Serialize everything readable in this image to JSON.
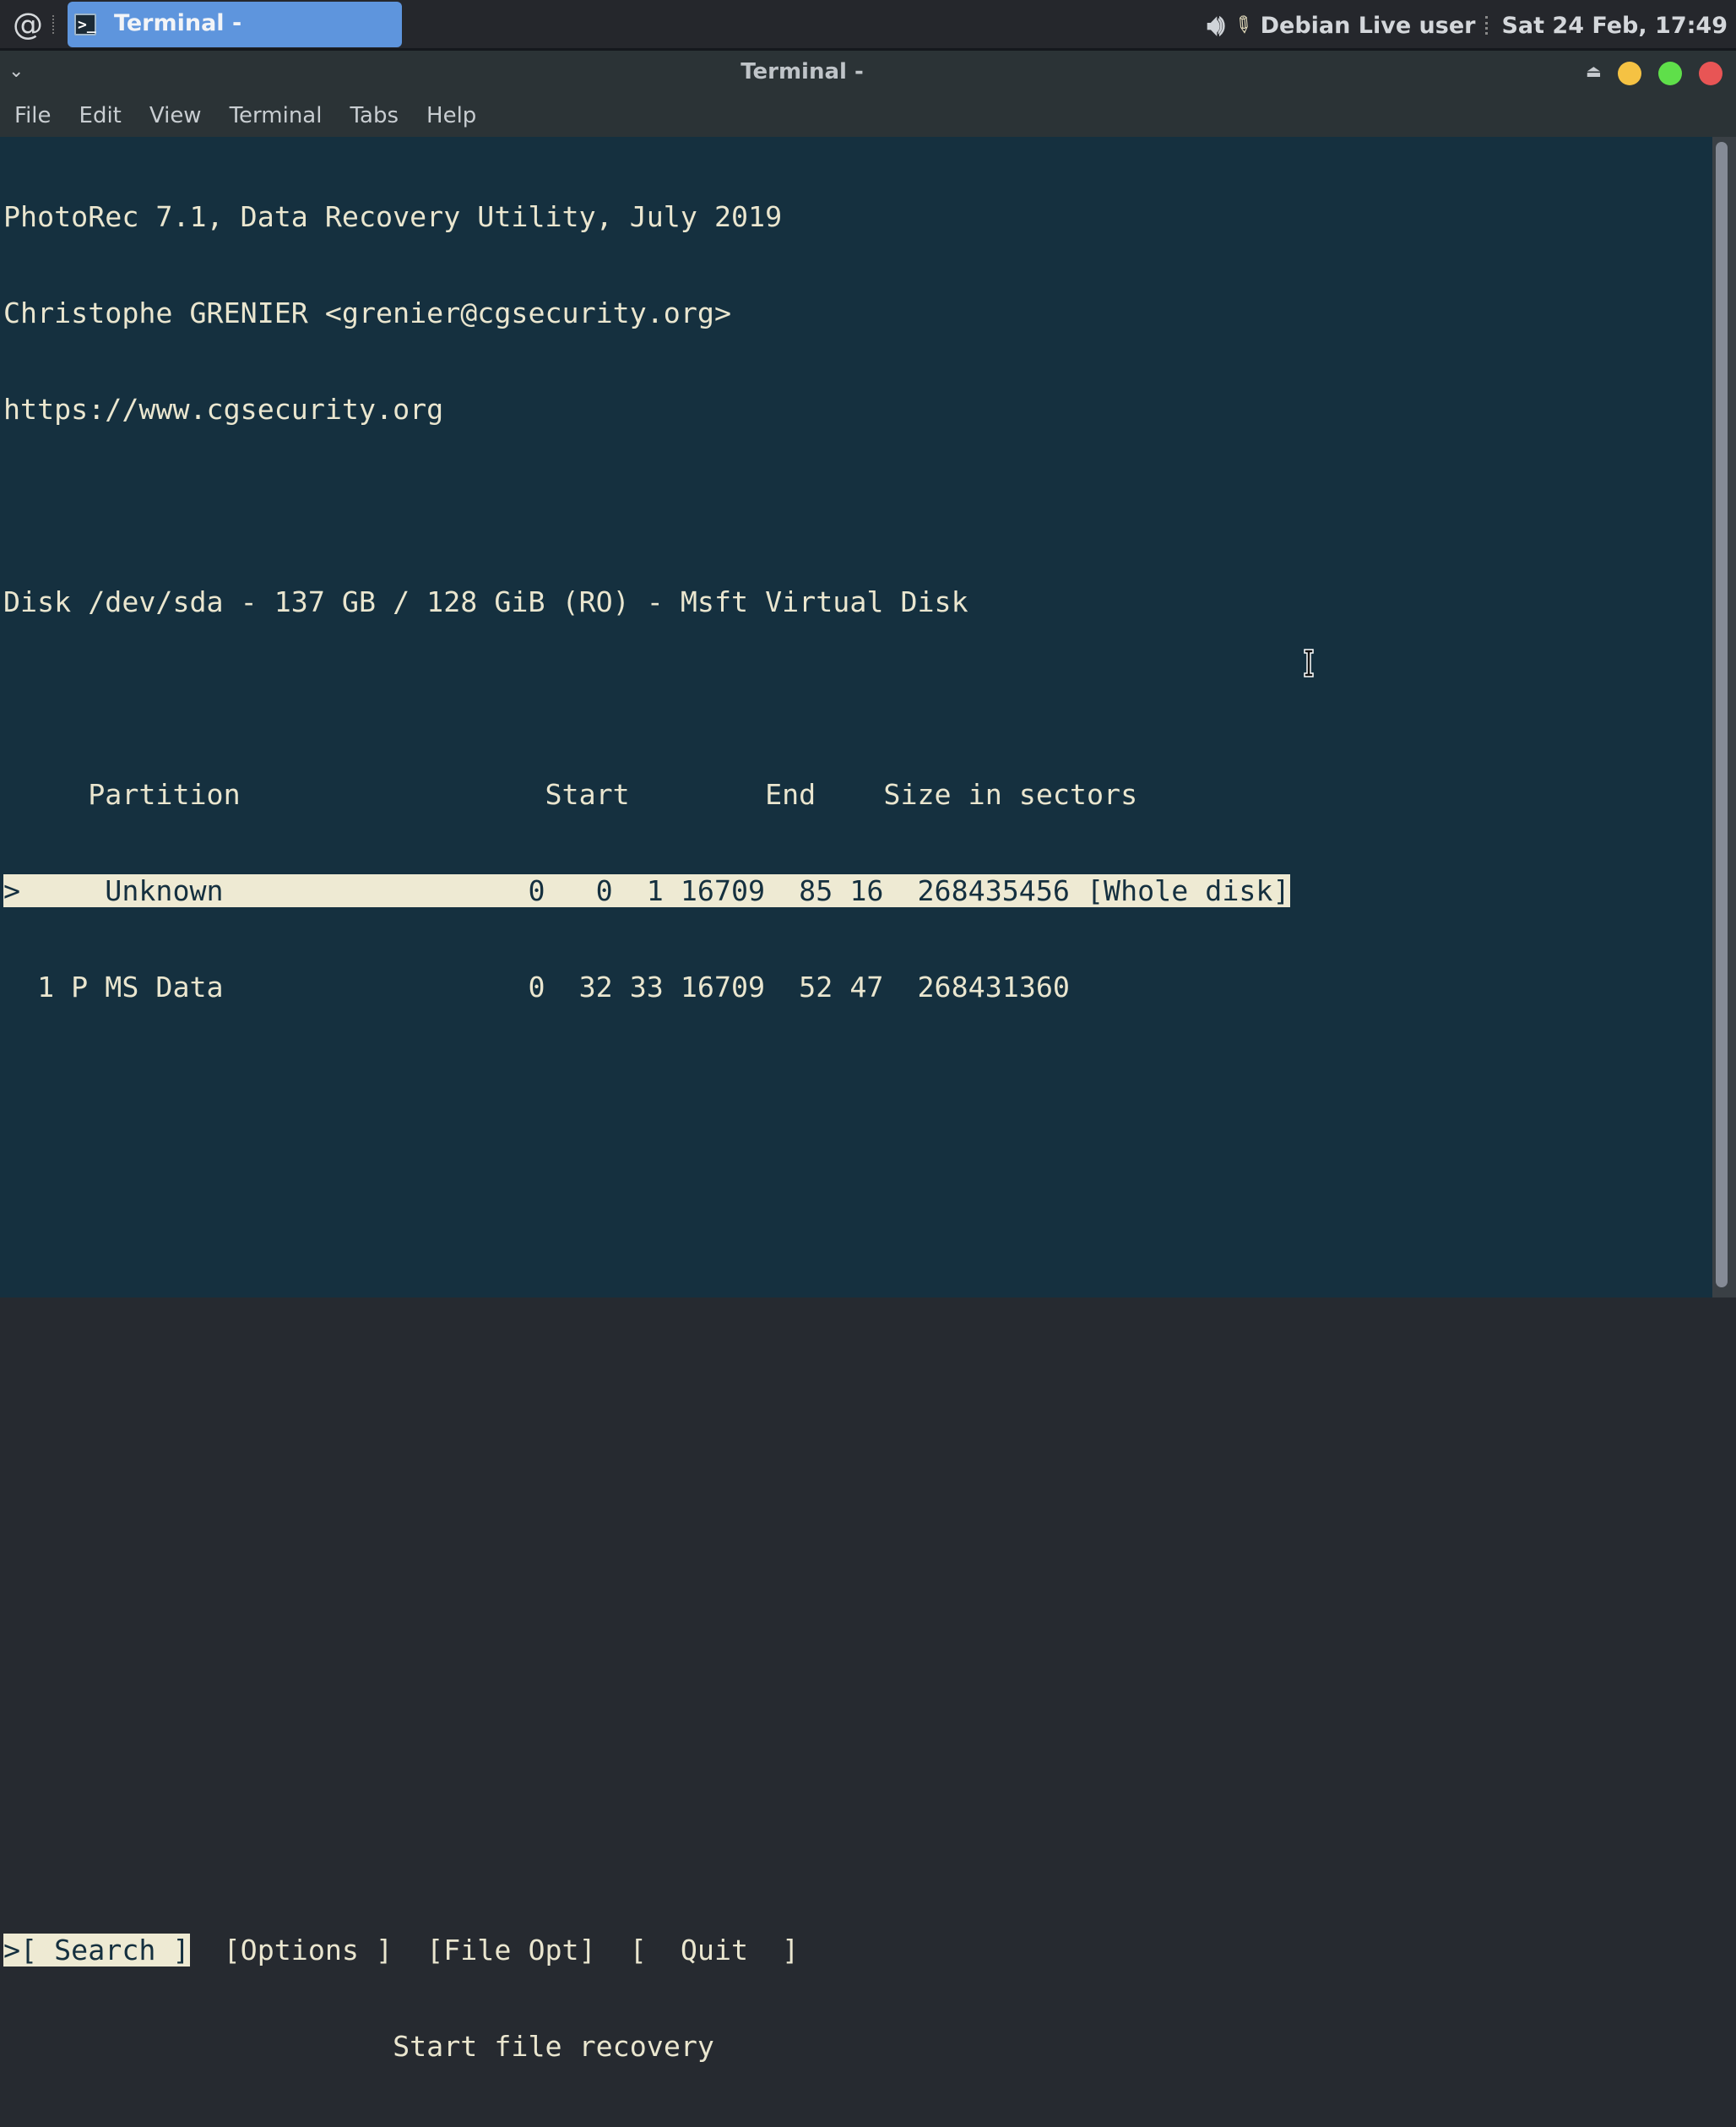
{
  "panel": {
    "launcher_icon": "debian-swirl-icon",
    "task_label": "Terminal -",
    "task_icon": "terminal-icon",
    "user": "Debian Live user",
    "datetime": "Sat 24 Feb, 17:49"
  },
  "window": {
    "title": "Terminal -",
    "menu": [
      "File",
      "Edit",
      "View",
      "Terminal",
      "Tabs",
      "Help"
    ],
    "controls": {
      "minimize_color": "#f5c243",
      "maximize_color": "#5fdf4a",
      "close_color": "#e85555"
    }
  },
  "terminal": {
    "header": [
      "PhotoRec 7.1, Data Recovery Utility, July 2019",
      "Christophe GRENIER <grenier@cgsecurity.org>",
      "https://www.cgsecurity.org"
    ],
    "disk": "Disk /dev/sda - 137 GB / 128 GiB (RO) - Msft Virtual Disk",
    "table_header": "     Partition                  Start        End    Size in sectors",
    "rows": [
      {
        "text": ">     Unknown                  0   0  1 16709  85 16  268435456 [Whole disk]",
        "selected": true
      },
      {
        "text": "  1 P MS Data                  0  32 33 16709  52 47  268431360",
        "selected": false
      }
    ],
    "actions": {
      "search": ">[ Search ]",
      "options": "[Options ]",
      "file_opt": "[File Opt]",
      "quit": "[  Quit  ]"
    },
    "hint": "Start file recovery"
  }
}
